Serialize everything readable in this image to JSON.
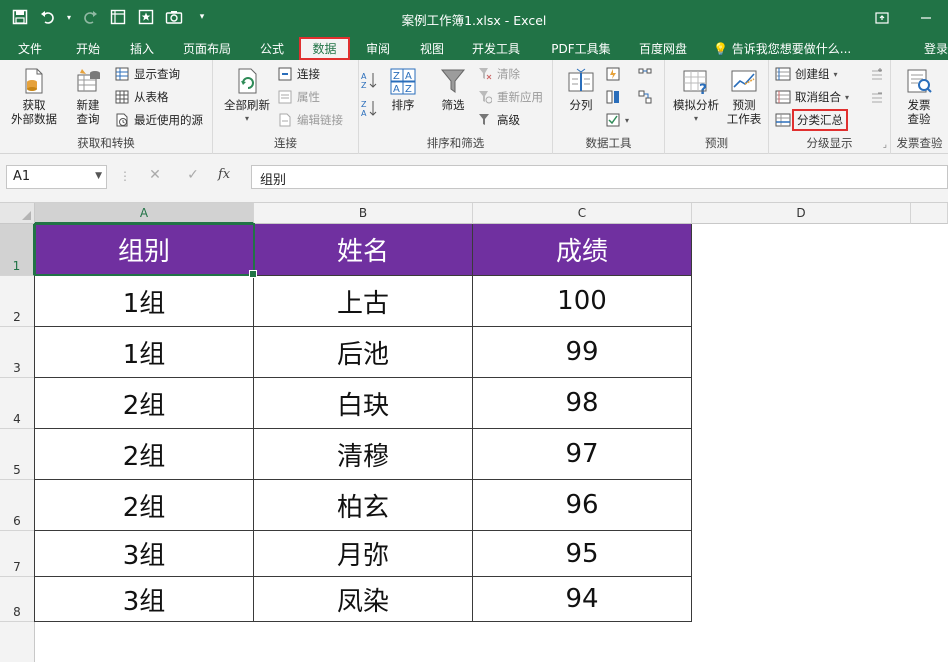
{
  "window": {
    "title": "案例工作簿1.xlsx - Excel"
  },
  "qat": {
    "save_icon": "save-icon",
    "undo_icon": "undo-icon",
    "redo_icon": "redo-icon"
  },
  "tabs": [
    "文件",
    "开始",
    "插入",
    "页面布局",
    "公式",
    "数据",
    "审阅",
    "视图",
    "开发工具",
    "PDF工具集",
    "百度网盘"
  ],
  "active_tab": "数据",
  "tell_me": "告诉我您想要做什么...",
  "login": "登录",
  "ribbon": {
    "get_transform": {
      "group_label": "获取和转换",
      "get_external_data": "获取\n外部数据",
      "new_query": "新建\n查询",
      "show_queries": "显示查询",
      "from_table": "从表格",
      "recent_sources": "最近使用的源"
    },
    "connections": {
      "group_label": "连接",
      "refresh_all": "全部刷新",
      "connections": "连接",
      "properties": "属性",
      "edit_links": "编辑链接"
    },
    "sort_filter": {
      "group_label": "排序和筛选",
      "sort": "排序",
      "filter": "筛选",
      "clear": "清除",
      "reapply": "重新应用",
      "advanced": "高级"
    },
    "data_tools": {
      "group_label": "数据工具",
      "text_to_columns": "分列"
    },
    "forecast": {
      "group_label": "预测",
      "what_if": "模拟分析",
      "forecast_sheet": "预测\n工作表"
    },
    "outline": {
      "group_label": "分级显示",
      "group": "创建组",
      "ungroup": "取消组合",
      "subtotal": "分类汇总"
    },
    "invoice": {
      "group_label": "发票查验",
      "invoice_check": "发票\n查验"
    }
  },
  "formula_bar": {
    "name_box": "A1",
    "formula": "组别"
  },
  "sheet": {
    "columns": [
      "A",
      "B",
      "C",
      "D"
    ],
    "rows": [
      "1",
      "2",
      "3",
      "4",
      "5",
      "6",
      "7",
      "8"
    ],
    "header": [
      "组别",
      "姓名",
      "成绩"
    ],
    "data": [
      [
        "1组",
        "上古",
        "100"
      ],
      [
        "1组",
        "后池",
        "99"
      ],
      [
        "2组",
        "白玦",
        "98"
      ],
      [
        "2组",
        "清穆",
        "97"
      ],
      [
        "2组",
        "柏玄",
        "96"
      ],
      [
        "3组",
        "月弥",
        "95"
      ],
      [
        "3组",
        "凤染",
        "94"
      ]
    ]
  },
  "colors": {
    "excel_green": "#217346",
    "header_fill": "#7030a0",
    "highlight_box": "#e0302f"
  }
}
